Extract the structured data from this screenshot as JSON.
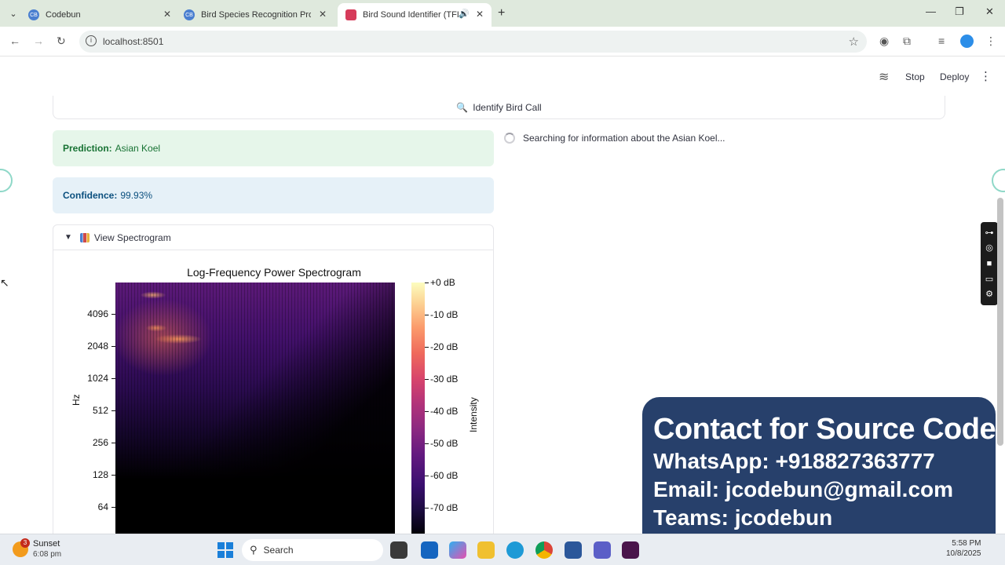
{
  "browser": {
    "tabs": [
      {
        "title": "Codebun",
        "favicon": "CB"
      },
      {
        "title": "Bird Species Recognition Projec",
        "favicon": "CB"
      },
      {
        "title": "Bird Sound Identifier (TFLite",
        "favicon": "streamlit",
        "active": true
      }
    ],
    "url": "localhost:8501"
  },
  "header": {
    "stop_label": "Stop",
    "deploy_label": "Deploy"
  },
  "main": {
    "identify_button": "Identify Bird Call",
    "prediction_label": "Prediction:",
    "prediction_value": "Asian Koel",
    "confidence_label": "Confidence:",
    "confidence_value": "99.93%",
    "searching_text": "Searching for information about the Asian Koel...",
    "expander_label": "View Spectrogram"
  },
  "chart_data": {
    "type": "heatmap",
    "title": "Log-Frequency Power Spectrogram",
    "ylabel": "Hz",
    "y_ticks": [
      "4096",
      "2048",
      "1024",
      "512",
      "256",
      "128",
      "64"
    ],
    "colorbar_label": "Intensity",
    "colorbar_ticks": [
      "+0 dB",
      "-10 dB",
      "-20 dB",
      "-30 dB",
      "-40 dB",
      "-50 dB",
      "-60 dB",
      "-70 dB"
    ],
    "colormap": "magma"
  },
  "contact": {
    "title": "Contact for Source Code",
    "whatsapp": "WhatsApp: +918827363777",
    "email": "Email: jcodebun@gmail.com",
    "teams": "Teams: jcodebun"
  },
  "taskbar": {
    "weather_badge": "3",
    "weather_title": "Sunset",
    "weather_time": "6:08 pm",
    "search_label": "Search",
    "clock_time": "5:58 PM",
    "clock_date": "10/8/2025"
  },
  "colors": {
    "success_bg": "#e6f6ea",
    "info_bg": "#e6f1f8",
    "contact_bg": "#27406b"
  }
}
